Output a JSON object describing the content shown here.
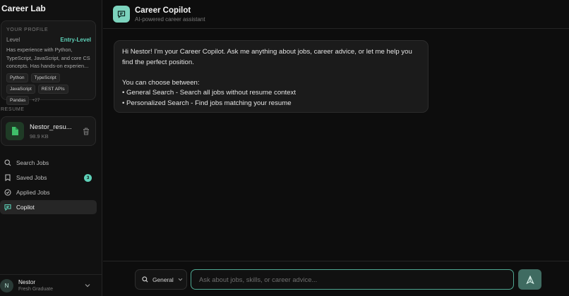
{
  "app": {
    "brand": "Career Lab"
  },
  "profile": {
    "section_label": "YOUR PROFILE",
    "level_key": "Level",
    "level_value": "Entry-Level",
    "description": "Has experience with Python, TypeScript, JavaScript, and core CS concepts. Has hands-on experien...",
    "skills": [
      "Python",
      "TypeScript",
      "JavaScript",
      "REST APIs",
      "Pandas"
    ],
    "more_skills": "+27"
  },
  "resume": {
    "section_label": "RESUME",
    "file_name": "Nestor_resu...",
    "file_size": "98.9 KB"
  },
  "nav": {
    "items": [
      {
        "label": "Search Jobs",
        "icon": "search-icon"
      },
      {
        "label": "Saved Jobs",
        "icon": "bookmark-icon",
        "badge": "3"
      },
      {
        "label": "Applied Jobs",
        "icon": "check-circle-icon"
      },
      {
        "label": "Copilot",
        "icon": "chat-icon",
        "active": true
      }
    ]
  },
  "user": {
    "initial": "N",
    "name": "Nestor",
    "role": "Fresh Graduate"
  },
  "header": {
    "title": "Career Copilot",
    "subtitle": "AI-powered career assistant"
  },
  "message": {
    "line1": "Hi Nestor! I'm your Career Copilot. Ask me anything about jobs, career advice, or let me help you find the perfect position.",
    "line2": "You can choose between:",
    "bullet1": "• General Search - Search all jobs without resume context",
    "bullet2": "• Personalized Search - Find jobs matching your resume"
  },
  "composer": {
    "mode": "General",
    "placeholder": "Ask about jobs, skills, or career advice..."
  },
  "colors": {
    "accent": "#5ed1b8",
    "background": "#0d0d0d",
    "sidebar": "#111111"
  }
}
